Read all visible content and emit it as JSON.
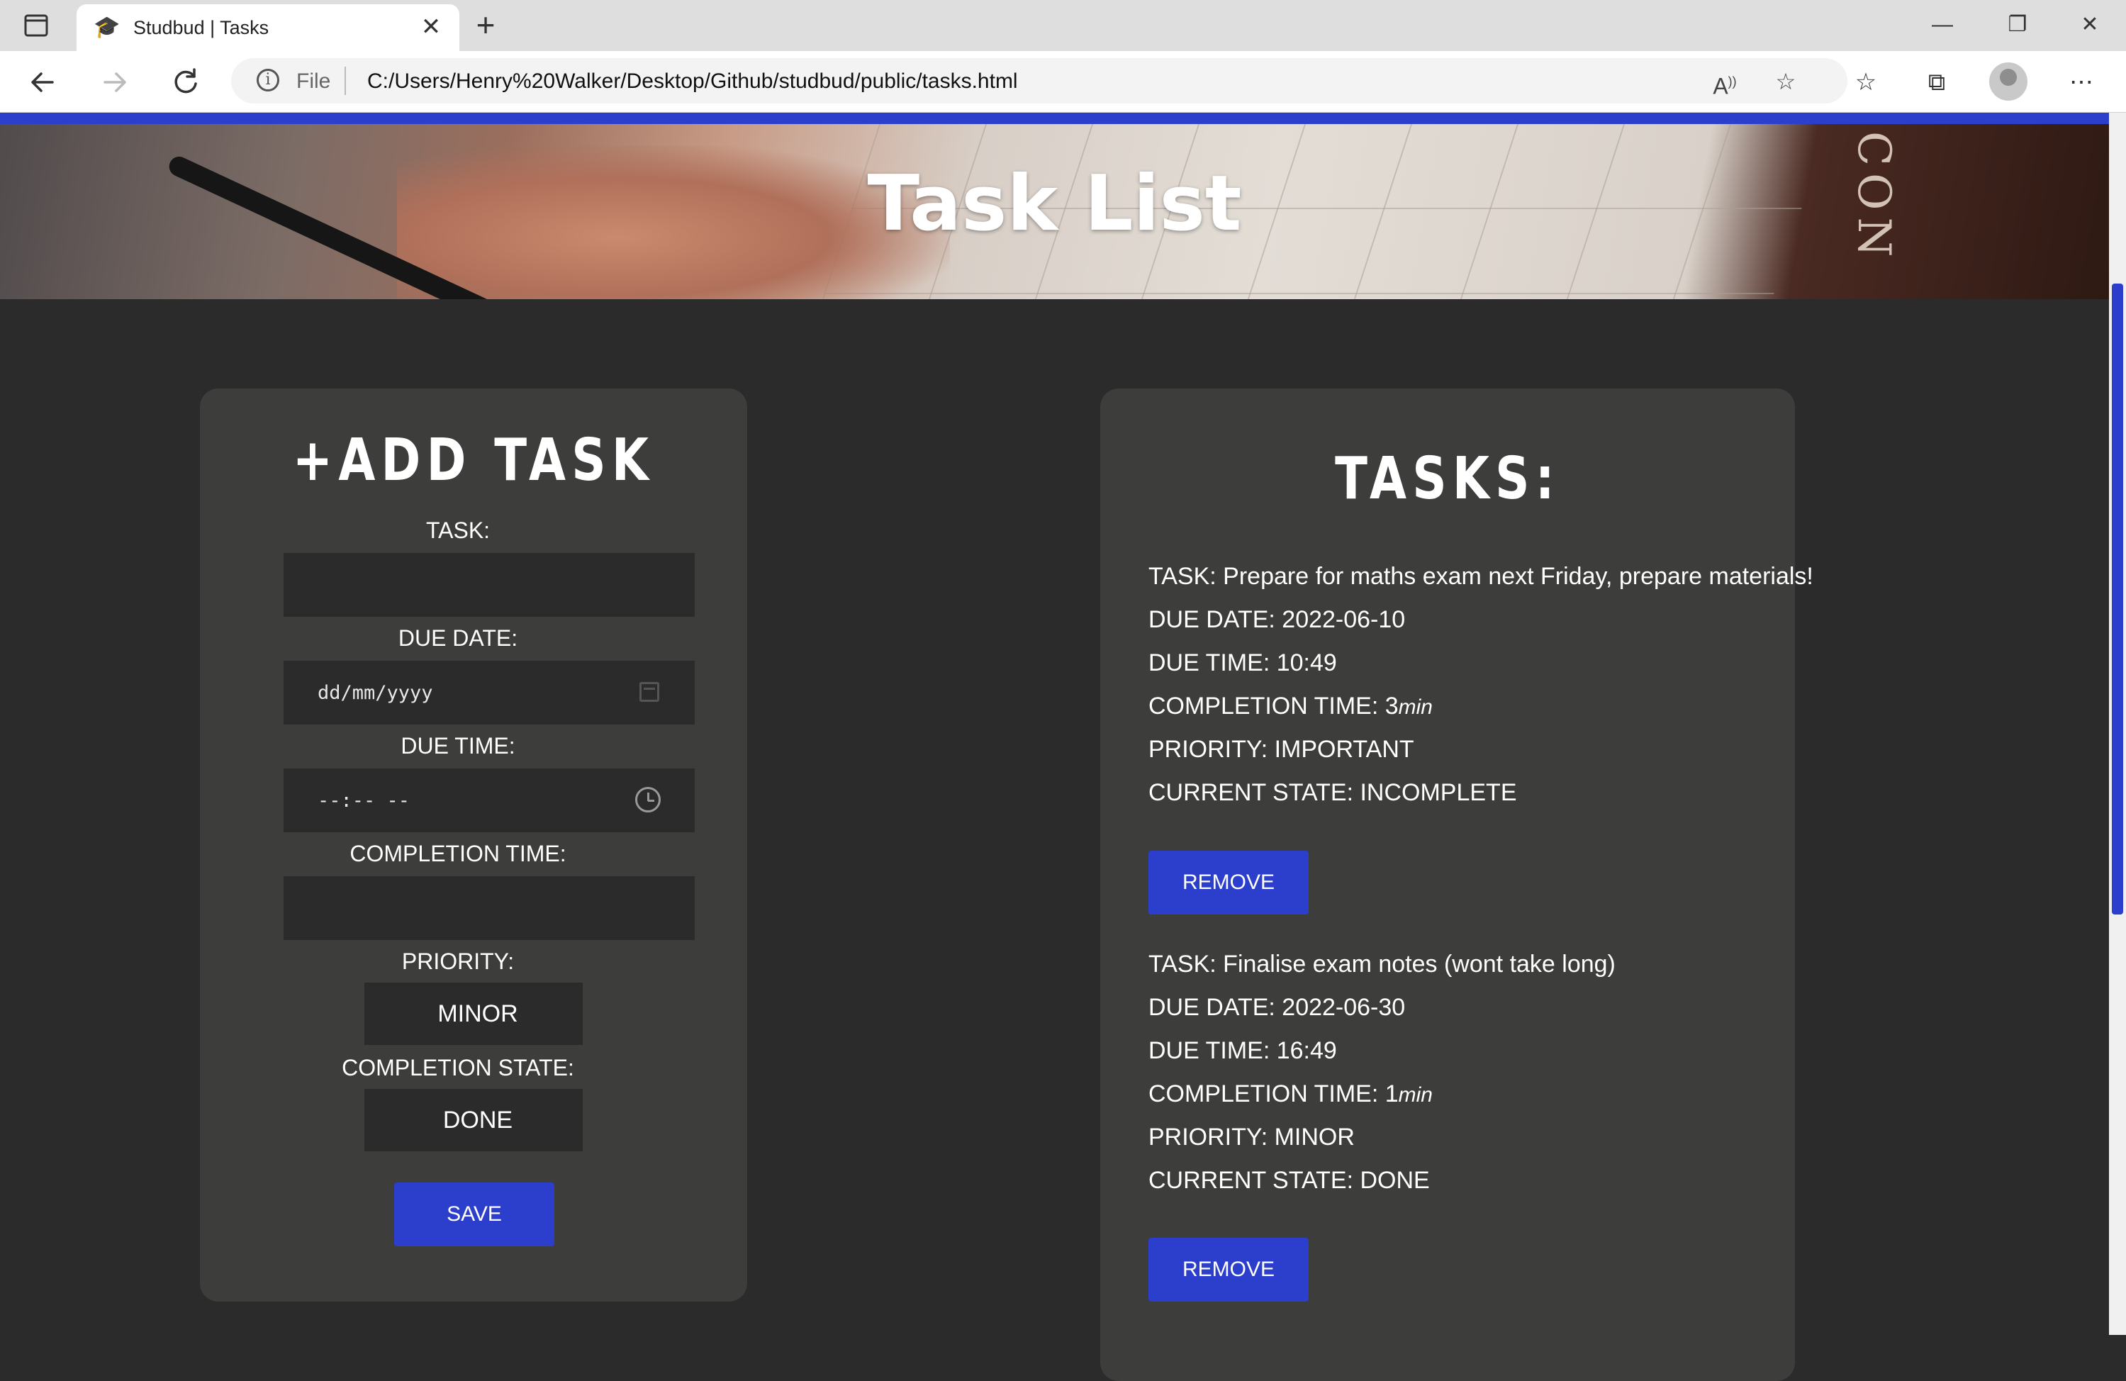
{
  "browser": {
    "tab_title": "Studbud | Tasks",
    "tab_close": "✕",
    "new_tab": "+",
    "url_scheme": "File",
    "url": "C:/Users/Henry%20Walker/Desktop/Github/studbud/public/tasks.html",
    "icons": {
      "tab_icon": "graduation-cap-icon",
      "back": "back-arrow-icon",
      "forward": "forward-arrow-icon",
      "reload": "reload-icon",
      "read_aloud": "read-aloud-icon",
      "add_favorite": "add-favorite-icon",
      "favorites": "favorites-icon",
      "collections": "collections-icon",
      "more": "more-icon"
    },
    "accent_color": "#2b3fcc"
  },
  "hero": {
    "title": "Task List",
    "book_text": "CON"
  },
  "add_task": {
    "heading": "+ADD TASK",
    "task_label": "TASK:",
    "task_value": "",
    "due_date_label": "DUE DATE:",
    "due_date_placeholder": "dd/mm/yyyy",
    "due_time_label": "DUE TIME:",
    "due_time_placeholder": "--:-- --",
    "completion_time_label": "COMPLETION TIME:",
    "completion_time_value": "",
    "priority_label": "PRIORITY:",
    "priority_selected": "MINOR",
    "completion_state_label": "COMPLETION STATE:",
    "completion_state_selected": "DONE",
    "save_label": "SAVE"
  },
  "tasks_panel": {
    "heading": "TASKS:",
    "remove_label": "REMOVE",
    "tasks": [
      {
        "task": "TASK: Prepare for maths exam next Friday, prepare materials!",
        "due_date": "DUE DATE: 2022-06-10",
        "due_time": "DUE TIME: 10:49",
        "completion_time": "COMPLETION TIME: 3",
        "completion_unit": "min",
        "priority": "PRIORITY: IMPORTANT",
        "state": "CURRENT STATE: INCOMPLETE"
      },
      {
        "task": "TASK: Finalise exam notes (wont take long)",
        "due_date": "DUE DATE: 2022-06-30",
        "due_time": "DUE TIME: 16:49",
        "completion_time": "COMPLETION TIME: 1",
        "completion_unit": "min",
        "priority": "PRIORITY: MINOR",
        "state": "CURRENT STATE: DONE"
      }
    ]
  }
}
